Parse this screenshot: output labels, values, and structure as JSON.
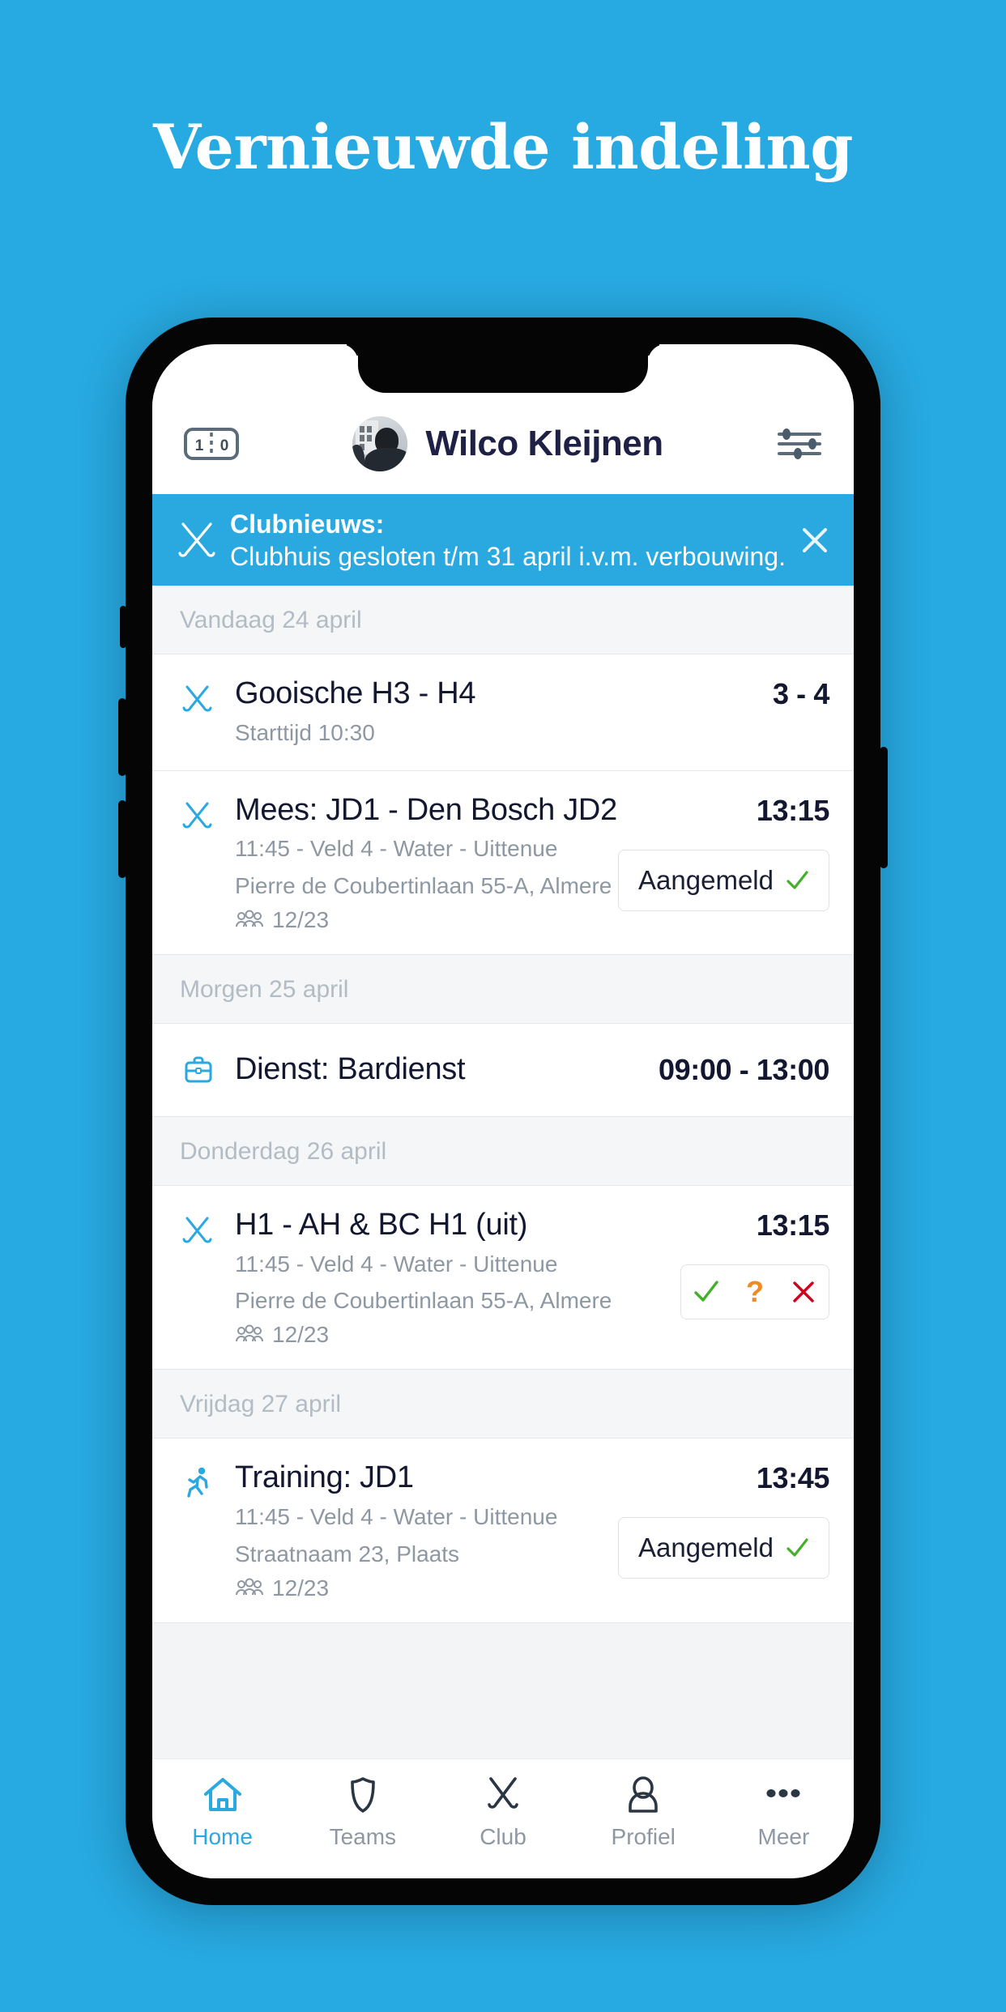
{
  "headline": "Vernieuwde indeling",
  "theme": {
    "background": "#27a9e1",
    "accent": "#2aa8e0",
    "text_dark": "#131730",
    "text_muted": "#8e98a3",
    "green": "#43b02a",
    "orange": "#f08a24",
    "red": "#d0021b"
  },
  "header": {
    "score_icon": "scoreboard-icon",
    "score_home": "1",
    "score_away": "0",
    "user_name": "Wilco Kleijnen",
    "avatar": "user-avatar",
    "filter_icon": "sliders-icon"
  },
  "news": {
    "icon": "crossed-hockey-sticks-icon",
    "title": "Clubnieuws:",
    "body": "Clubhuis gesloten t/m 31 april i.v.m. verbouwing.",
    "close_icon": "close-icon"
  },
  "days": [
    {
      "label": "Vandaag 24 april",
      "items": [
        {
          "icon": "hockey-sticks-icon",
          "title": "Gooische H3 - H4",
          "lines": [
            "Starttijd 10:30"
          ],
          "count": null,
          "time": "3 - 4",
          "action": null
        }
      ]
    },
    {
      "label": "Morgen 25 april",
      "items": [
        {
          "icon": "briefcase-icon",
          "title": "Dienst: Bardienst",
          "lines": [],
          "count": null,
          "time": "09:00 - 13:00",
          "action": null
        }
      ]
    },
    {
      "label": "Donderdag 26 april",
      "items": [
        {
          "icon": "hockey-sticks-icon",
          "title": "H1 - AH & BC H1 (uit)",
          "lines": [
            "11:45 - Veld 4 - Water - Uittenue",
            "Pierre de Coubertinlaan 55-A, Almere"
          ],
          "count": "12/23",
          "time": "13:15",
          "action": "choice"
        }
      ]
    },
    {
      "label": "Vrijdag 27 april",
      "items": [
        {
          "icon": "running-icon",
          "title": "Training: JD1",
          "lines": [
            "11:45 - Veld 4 - Water - Uittenue",
            "Straatnaam 23, Plaats"
          ],
          "count": "12/23",
          "time": "13:45",
          "action": "attend"
        }
      ]
    }
  ],
  "second_item": {
    "icon": "hockey-sticks-icon",
    "title": "Mees: JD1 - Den Bosch JD2",
    "lines": [
      "11:45 - Veld 4 - Water - Uittenue",
      "Pierre de Coubertinlaan 55-A, Almere"
    ],
    "count": "12/23",
    "time": "13:15",
    "action_label": "Aangemeld"
  },
  "attend_label": "Aangemeld",
  "choice": {
    "yes": "check-icon",
    "maybe": "?",
    "no": "cross-icon"
  },
  "tabbar": [
    {
      "label": "Home",
      "icon": "home-icon",
      "active": true
    },
    {
      "label": "Teams",
      "icon": "shield-icon",
      "active": false
    },
    {
      "label": "Club",
      "icon": "hockey-sticks-crossed-icon",
      "active": false
    },
    {
      "label": "Profiel",
      "icon": "person-icon",
      "active": false
    },
    {
      "label": "Meer",
      "icon": "ellipsis-icon",
      "active": false
    }
  ]
}
